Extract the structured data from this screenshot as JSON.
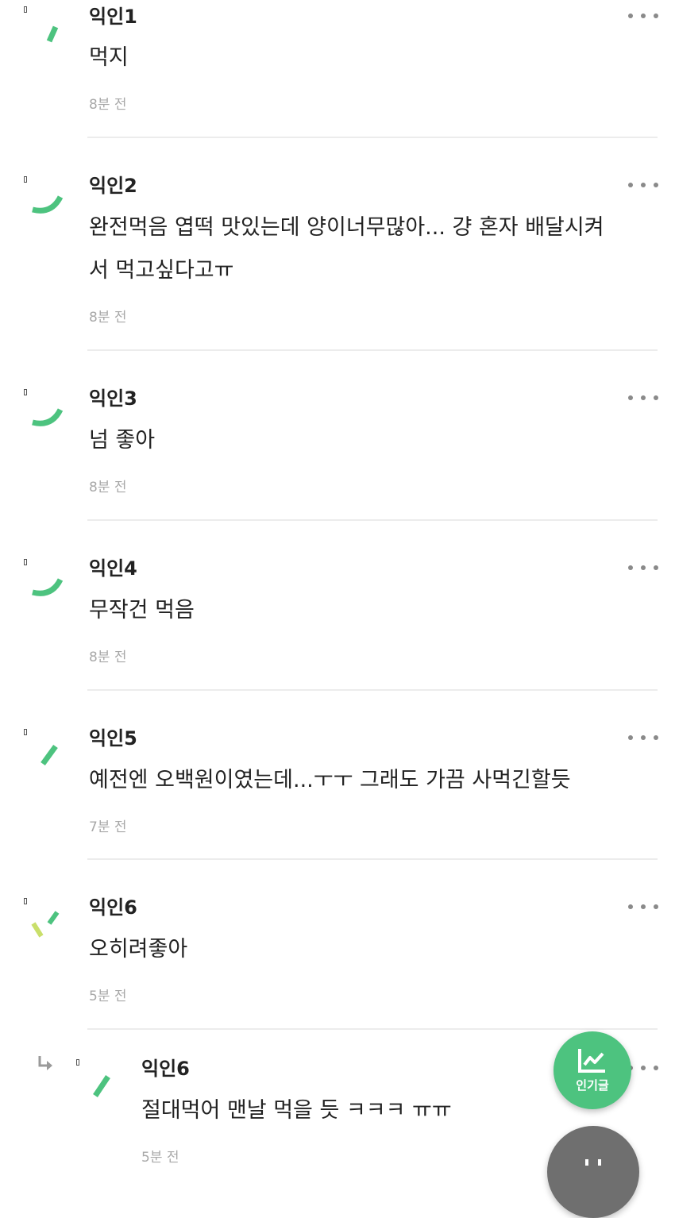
{
  "comments": [
    {
      "nickname": "익인1",
      "lines": [
        "먹지"
      ],
      "time": "8분 전"
    },
    {
      "nickname": "익인2",
      "lines": [
        "완전먹음 엽떡 맛있는데 양이너무많아... 걍 혼자 배달시켜",
        "서 먹고싶다고ㅠ"
      ],
      "time": "8분 전"
    },
    {
      "nickname": "익인3",
      "lines": [
        "넘 좋아"
      ],
      "time": "8분 전"
    },
    {
      "nickname": "익인4",
      "lines": [
        "무작건 먹음"
      ],
      "time": "8분 전"
    },
    {
      "nickname": "익인5",
      "lines": [
        "예전엔 오백원이였는데...ㅜㅜ 그래도 가끔 사먹긴할듯"
      ],
      "time": "7분 전"
    },
    {
      "nickname": "익인6",
      "lines": [
        "오히려좋아"
      ],
      "time": "5분 전"
    }
  ],
  "reply": {
    "nickname": "익인6",
    "lines": [
      "절대먹어 맨날 먹을 듯 ㅋㅋㅋ ㅠㅠ"
    ],
    "time": "5분 전"
  },
  "popular_button": {
    "label": "인기글",
    "icon": "trending-chart-icon"
  },
  "icons": {
    "more": "more-dots-icon",
    "reply": "reply-arrow-icon",
    "avatar": "loading-spinner-avatar-icon"
  },
  "colors": {
    "accent_green": "#4dc37f",
    "avatar_yellow": "#c9df6a",
    "time_gray": "#a8a8a8",
    "divider": "#ececec"
  }
}
